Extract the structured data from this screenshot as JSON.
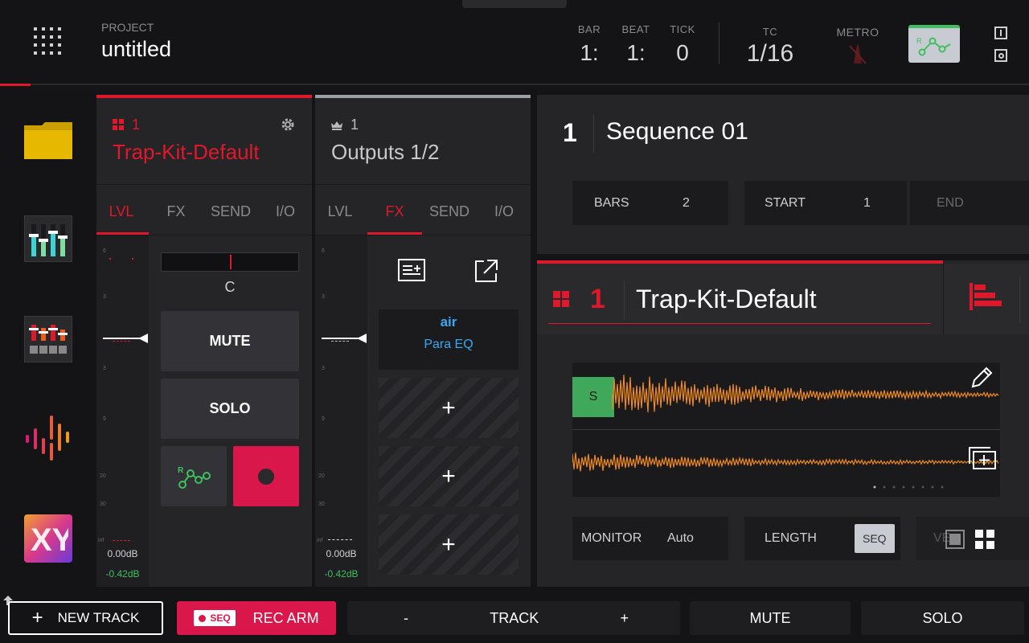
{
  "header": {
    "project_label": "PROJECT",
    "project_name": "untitled",
    "bar_label": "BAR",
    "bar_value": "1:",
    "beat_label": "BEAT",
    "beat_value": "1:",
    "tick_label": "TICK",
    "tick_value": "0",
    "tc_label": "TC",
    "tc_value": "1/16",
    "metro_label": "METRO"
  },
  "track_panel": {
    "number": "1",
    "name": "Trap-Kit-Default",
    "tabs": [
      "LVL",
      "FX",
      "SEND",
      "I/O"
    ],
    "pan_value": "C",
    "mute_label": "MUTE",
    "solo_label": "SOLO",
    "level_db": "0.00dB",
    "peak_db": "-0.42dB",
    "scale": [
      "6",
      "3",
      "",
      "3",
      "9",
      "20",
      "30",
      "inf"
    ]
  },
  "output_panel": {
    "number": "1",
    "name": "Outputs 1/2",
    "tabs": [
      "LVL",
      "FX",
      "SEND",
      "I/O"
    ],
    "plugin_brand": "air",
    "plugin_name": "Para EQ",
    "level_db": "0.00dB",
    "peak_db": "-0.42dB",
    "add": "+"
  },
  "sequence": {
    "number": "1",
    "name": "Sequence 01",
    "bars_label": "BARS",
    "bars_value": "2",
    "start_label": "START",
    "start_value": "1",
    "end_label": "END"
  },
  "track_detail": {
    "number": "1",
    "name": "Trap-Kit-Default",
    "s_marker": "S",
    "monitor_label": "MONITOR",
    "monitor_value": "Auto",
    "length_label": "LENGTH",
    "length_value": "SEQ",
    "vel_label": "VE"
  },
  "bottom": {
    "new_track": "NEW TRACK",
    "seq_badge": "SEQ",
    "rec_arm": "REC ARM",
    "minus": "-",
    "track": "TRACK",
    "plus": "+",
    "mute": "MUTE",
    "solo": "SOLO"
  },
  "colors": {
    "accent_red": "#e0182b",
    "rec_pink": "#d9174a",
    "wave_orange": "#f08a1c",
    "green": "#3fbf5f"
  }
}
